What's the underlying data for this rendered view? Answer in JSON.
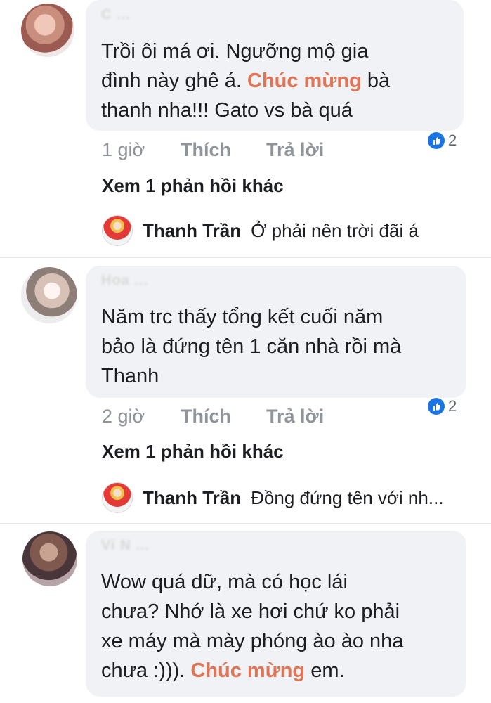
{
  "comments": [
    {
      "author_blurred": "C ...",
      "text_before": "Trồi ôi má ơi. Ngưỡng mộ gia\nđình này ghê á. ",
      "highlight": "Chúc mừng",
      "text_after": " bà\nthanh nha!!! Gato vs bà quá",
      "time": "1 giờ",
      "like_label": "Thích",
      "reply_label": "Trả lời",
      "reaction_count": "2",
      "more_replies": "Xem 1 phản hồi khác",
      "reply_author": "Thanh Trần",
      "reply_text": "Ở phải nên trời đãi á"
    },
    {
      "author_blurred": "Hoa ...",
      "text": "Năm trc thấy tổng kết cuối năm\nbảo là đứng tên 1 căn nhà rồi mà\nThanh",
      "time": "2 giờ",
      "like_label": "Thích",
      "reply_label": "Trả lời",
      "reaction_count": "2",
      "more_replies": "Xem 1 phản hồi khác",
      "reply_author": "Thanh Trần",
      "reply_text": "Đồng đứng tên với nh..."
    },
    {
      "author_blurred": "Vi N ...",
      "text_before": "Wow quá dữ, mà có học lái\nchưa? Nhớ là xe hơi chứ ko phải\nxe máy mà mày phóng ào ào nha\nchưa :))). ",
      "highlight": "Chúc mừng",
      "text_after": " em."
    }
  ],
  "colors": {
    "bubble": "#f0f2f5",
    "highlight": "#e07555",
    "like_blue": "#1b74e4",
    "meta_gray": "#8f939a"
  },
  "icons": {
    "reaction": "like-thumb-icon",
    "avatars": [
      "blurred-profile-photo",
      "reply-profile-photo"
    ]
  }
}
